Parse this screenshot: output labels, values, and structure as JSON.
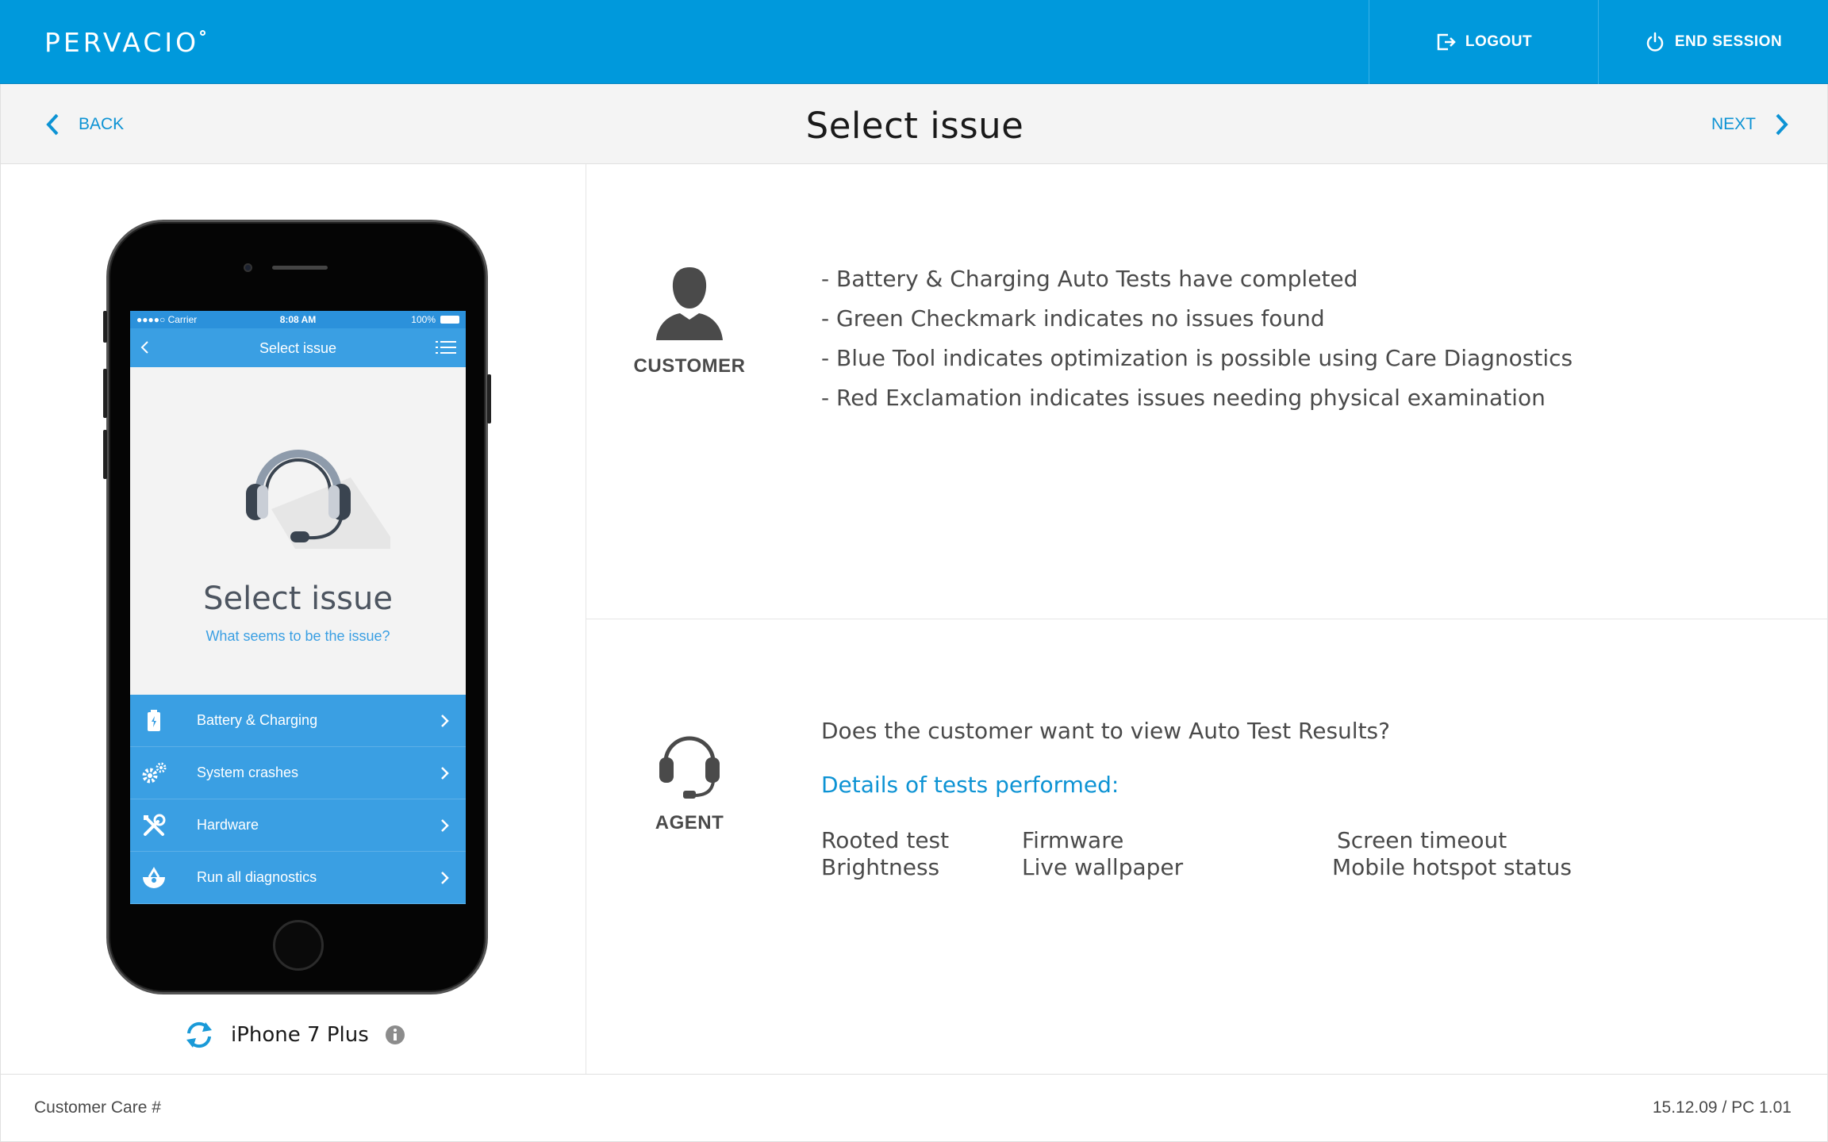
{
  "app": {
    "logo_text": "PERVACIO",
    "brand_color": "#0099dc"
  },
  "header": {
    "logout_label": "LOGOUT",
    "end_session_label": "END SESSION"
  },
  "subheader": {
    "back_label": "BACK",
    "title": "Select issue",
    "next_label": "NEXT"
  },
  "phone": {
    "status": {
      "carrier": "●●●●○ Carrier",
      "time": "8:08 AM",
      "battery": "100%"
    },
    "nav_title": "Select issue",
    "screen_title": "Select issue",
    "screen_subtitle": "What seems to be the issue?",
    "menu": [
      {
        "label": "Battery & Charging",
        "icon": "battery-icon"
      },
      {
        "label": "System crashes",
        "icon": "gears-icon"
      },
      {
        "label": "Hardware",
        "icon": "tools-icon"
      },
      {
        "label": "Run all diagnostics",
        "icon": "diagnostics-icon"
      }
    ]
  },
  "device": {
    "name": "iPhone 7 Plus"
  },
  "customer": {
    "label": "CUSTOMER",
    "bullets": [
      "- Battery & Charging Auto Tests have completed",
      "- Green Checkmark indicates no issues found",
      "- Blue Tool indicates optimization is possible using Care Diagnostics",
      "- Red Exclamation indicates issues needing physical examination"
    ]
  },
  "agent": {
    "label": "AGENT",
    "question": "Does the customer want to view Auto Test Results?",
    "details_heading": "Details of tests performed:",
    "tests": [
      "Rooted test",
      "Firmware",
      "Screen timeout",
      "Brightness",
      "Live wallpaper",
      "Mobile hotspot status"
    ]
  },
  "footer": {
    "left": "Customer Care #",
    "right": "15.12.09 / PC 1.01"
  }
}
